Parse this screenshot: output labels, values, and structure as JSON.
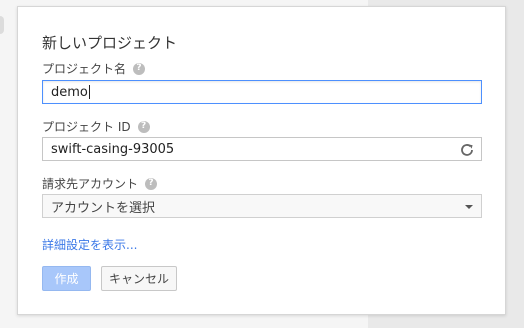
{
  "dialog": {
    "title": "新しいプロジェクト",
    "project_name": {
      "label": "プロジェクト名",
      "value": "demo",
      "help_icon": "question-mark-icon"
    },
    "project_id": {
      "label": "プロジェクト ID",
      "value": "swift-casing-93005",
      "help_icon": "question-mark-icon",
      "action_icon": "refresh-icon"
    },
    "billing_account": {
      "label": "請求先アカウント",
      "selected": "アカウントを選択",
      "help_icon": "question-mark-icon",
      "dropdown_icon": "triangle-down-icon"
    },
    "advanced_link": "詳細設定を表示...",
    "buttons": {
      "create": "作成",
      "cancel": "キャンセル"
    }
  },
  "colors": {
    "accent": "#4d90fe",
    "link": "#3b78e7",
    "create_disabled": "#a8c7fa"
  }
}
